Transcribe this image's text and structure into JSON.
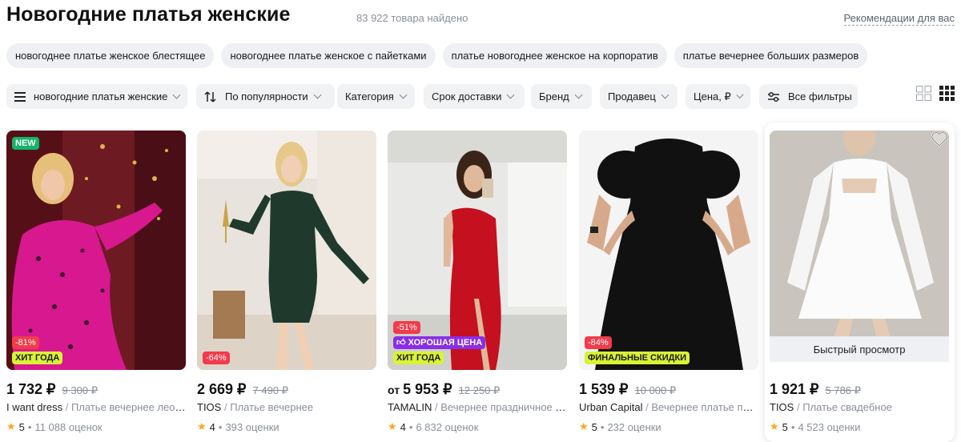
{
  "header": {
    "title": "Новогодние платья женские",
    "count": "83 922 товара найдено",
    "recommendations_link": "Рекомендации для вас"
  },
  "suggestions": [
    "новогоднее платье женское блестящее",
    "новогоднее платье женское с пайетками",
    "платье новогоднее женское на корпоратив",
    "платье вечернее больших размеров"
  ],
  "filters": {
    "search_category": "новогодние платья женские",
    "sort": "По популярности",
    "category": "Категория",
    "delivery": "Срок доставки",
    "brand": "Бренд",
    "seller": "Продавец",
    "price": "Цена, ₽",
    "all_filters": "Все фильтры",
    "active_view": "grid-small"
  },
  "products": [
    {
      "price_prefix": "",
      "price": "1 732 ₽",
      "old_price": "9 300 ₽",
      "brand": "I want dress",
      "sep": "/",
      "description": "Платье вечернее леопардовое",
      "rating": "5",
      "dot": "•",
      "reviews": "11 088 оценок",
      "badge_new": "NEW",
      "badge_discount": "-81%",
      "badge_extra": "ХИТ ГОДА",
      "photo_colors": {
        "bg": "#6e1a22",
        "dress": "#d8188f"
      }
    },
    {
      "price_prefix": "",
      "price": "2 669 ₽",
      "old_price": "7 490 ₽",
      "brand": "TIOS",
      "sep": "/",
      "description": "Платье вечернее",
      "rating": "4",
      "dot": "•",
      "reviews": "393 оценки",
      "badge_discount": "-64%",
      "photo_colors": {
        "bg": "#e9e3dd",
        "dress": "#1f3a2c"
      }
    },
    {
      "price_prefix": "от",
      "price": "5 953 ₽",
      "old_price": "12 250 ₽",
      "brand": "TAMALIN",
      "sep": "/",
      "description": "Вечернее праздничное платье",
      "rating": "4",
      "dot": "•",
      "reviews": "6 832 оценок",
      "badge_discount": "-51%",
      "badge_good": "ХОРОШАЯ ЦЕНА",
      "badge_extra": "ХИТ ГОДА",
      "photo_colors": {
        "bg": "#e8e8e6",
        "dress": "#c4101f"
      }
    },
    {
      "price_prefix": "",
      "price": "1 539 ₽",
      "old_price": "10 000 ₽",
      "brand": "Urban Capital",
      "sep": "/",
      "description": "Вечернее платье праздничное",
      "rating": "5",
      "dot": "•",
      "reviews": "232 оценки",
      "badge_discount": "-84%",
      "badge_extra": "ФИНАЛЬНЫЕ СКИДКИ",
      "photo_colors": {
        "bg": "#f4f4f4",
        "dress": "#111111"
      }
    },
    {
      "price_prefix": "",
      "price": "1 921 ₽",
      "old_price": "5 786 ₽",
      "brand": "TIOS",
      "sep": "/",
      "description": "Платье свадебное",
      "rating": "5",
      "dot": "•",
      "reviews": "4 523 оценки",
      "quick_view": "Быстрый просмотр",
      "photo_colors": {
        "bg": "#cfcac5",
        "dress": "#fbfbfb"
      }
    }
  ]
}
